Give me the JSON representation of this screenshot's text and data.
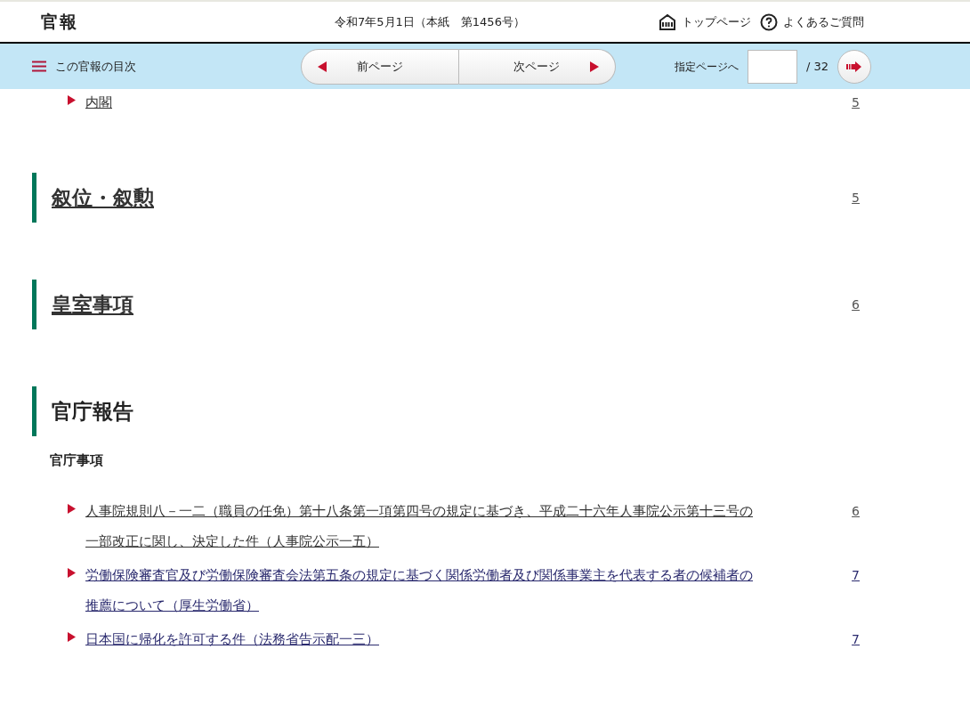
{
  "header": {
    "logo": "官報",
    "issue": "令和7年5月1日（本紙　第1456号）",
    "links": [
      {
        "kind": "home",
        "label": "トップページ"
      },
      {
        "kind": "help",
        "label": "よくあるご質問"
      }
    ]
  },
  "navbar": {
    "toc": "この官報の目次",
    "prev": "前ページ",
    "next": "次ページ",
    "jump_label": "指定ページへ",
    "total": "/ 32"
  },
  "contents": [
    {
      "kind": "item",
      "title": "内閣",
      "page": "5",
      "visited": true
    },
    {
      "kind": "heading",
      "title": "叙位・叙勲",
      "page": "5",
      "linked": true,
      "visited": true
    },
    {
      "kind": "heading",
      "title": "皇室事項",
      "page": "6",
      "linked": true,
      "visited": true
    },
    {
      "kind": "heading",
      "title": "官庁報告",
      "linked": false
    },
    {
      "kind": "subheading",
      "title": "官庁事項"
    },
    {
      "kind": "item",
      "title": "人事院規則八－一二（職員の任免）第十八条第一項第四号の規定に基づき、平成二十六年人事院公示第十三号の一部改正に関し、決定した件（人事院公示一五）",
      "page": "6",
      "visited": true
    },
    {
      "kind": "item",
      "title": "労働保険審査官及び労働保険審査会法第五条の規定に基づく関係労働者及び関係事業主を代表する者の候補者の推薦について（厚生労働省）",
      "page": "7",
      "visited": false
    },
    {
      "kind": "item",
      "title": "日本国に帰化を許可する件（法務省告示配一三）",
      "page": "7",
      "visited": false
    }
  ]
}
